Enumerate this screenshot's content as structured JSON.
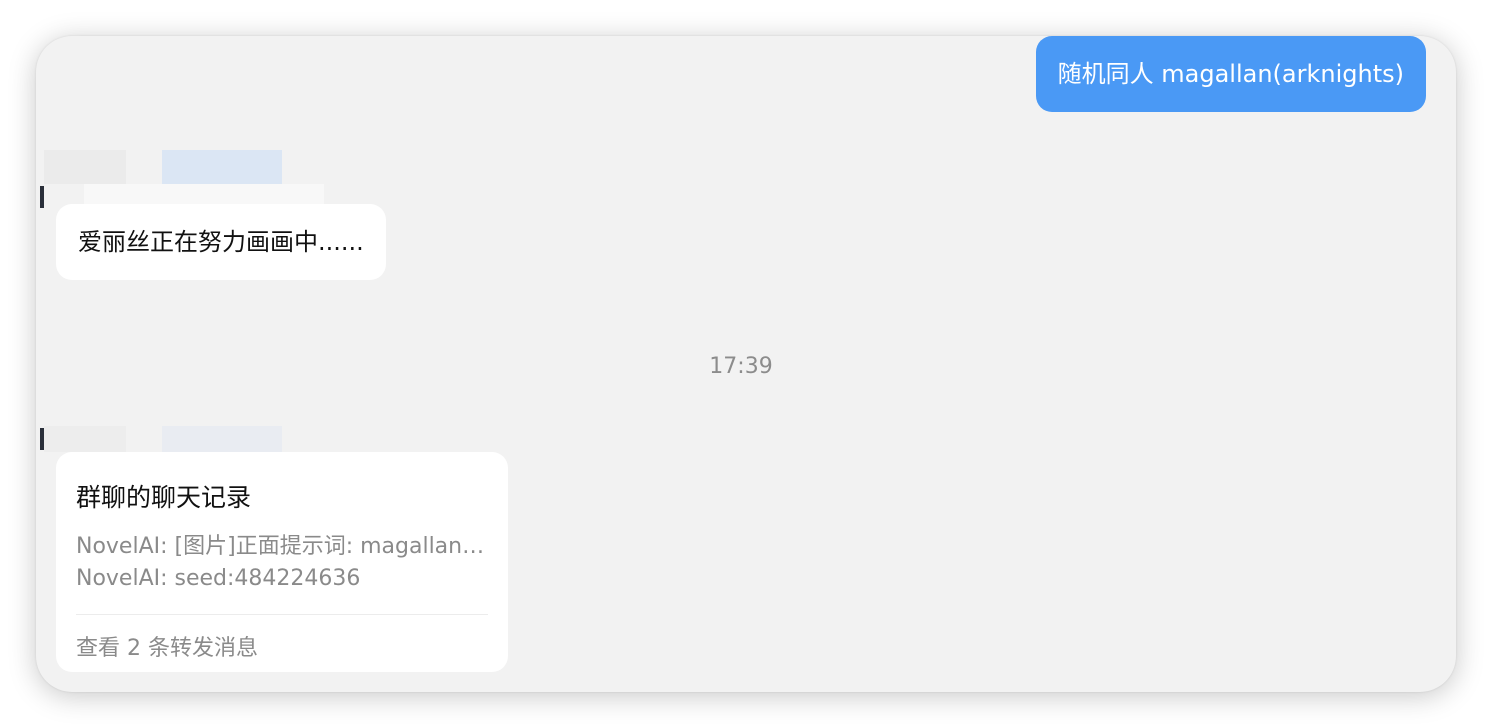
{
  "messages": {
    "outgoing_1": "随机同人 magallan(arknights)",
    "incoming_1": "爱丽丝正在努力画画中......",
    "timestamp": "17:39",
    "forward_card": {
      "title": "群聊的聊天记录",
      "line_1": "NovelAI: [图片]正面提示词: magallan(arknights), …",
      "line_2": "NovelAI: seed:484224636",
      "footer": "查看 2 条转发消息"
    }
  },
  "colors": {
    "outgoing_bubble": "#4a99f5",
    "incoming_bubble": "#ffffff",
    "background": "#f2f2f2"
  }
}
